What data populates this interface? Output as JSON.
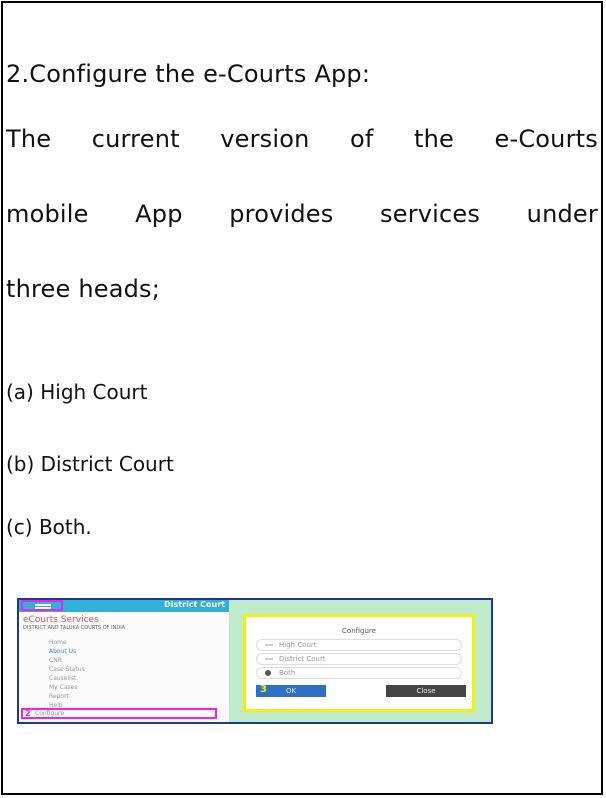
{
  "document": {
    "heading": "2.Configure the e-Courts App:",
    "para_line2_words": [
      "The",
      "current",
      "version",
      "of",
      "the",
      "e-Courts"
    ],
    "para_line3_words": [
      "mobile",
      "App",
      "provides",
      "services",
      "under"
    ],
    "para_line4": "three heads;",
    "items": [
      "(a) High Court",
      "(b) District Court",
      "(c) Both."
    ]
  },
  "screenshot": {
    "appbar_title": "District Court",
    "brand": "eCourts Services",
    "brand_sub": "DISTRICT AND TALUKA COURTS OF INDIA",
    "menu": [
      "Home",
      "About Us",
      "CNR",
      "Case Status",
      "Causelist",
      "My Cases",
      "Report",
      "Help"
    ],
    "menu_selected": "Configure",
    "menu_selected_step": "2",
    "dialog_title": "Configure",
    "options": [
      "High Court",
      "District Court",
      "Both"
    ],
    "selected_option": "Both",
    "ok_step": "3",
    "ok_label": "OK",
    "close_label": "Close",
    "colors": {
      "appbar": "#32b0d8",
      "highlight": "#ee22ee",
      "dialog_border": "#f0f014",
      "ok": "#2f6fc8",
      "background": "#bfeacb"
    }
  }
}
